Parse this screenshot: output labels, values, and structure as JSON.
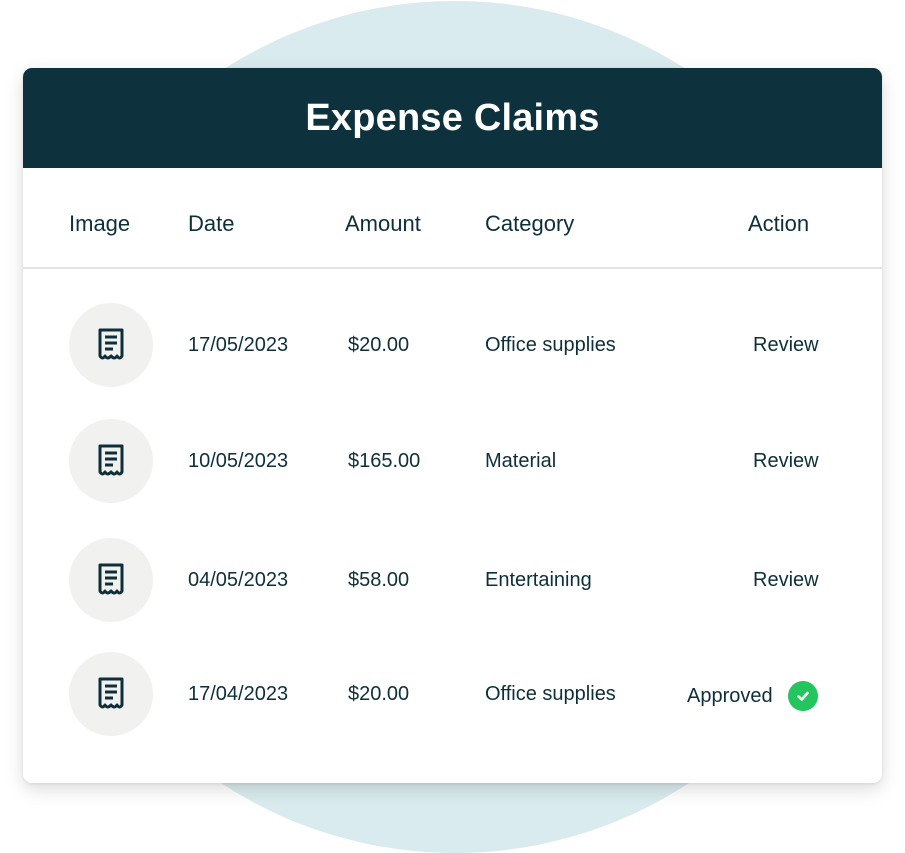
{
  "header": {
    "title": "Expense Claims"
  },
  "columns": {
    "image": "Image",
    "date": "Date",
    "amount": "Amount",
    "category": "Category",
    "action": "Action"
  },
  "rows": [
    {
      "icon": "receipt-icon",
      "date": "17/05/2023",
      "amount": "$20.00",
      "category": "Office supplies",
      "action": "Review",
      "status": "pending"
    },
    {
      "icon": "receipt-icon",
      "date": "10/05/2023",
      "amount": "$165.00",
      "category": "Material",
      "action": "Review",
      "status": "pending"
    },
    {
      "icon": "receipt-icon",
      "date": "04/05/2023",
      "amount": "$58.00",
      "category": "Entertaining",
      "action": "Review",
      "status": "pending"
    },
    {
      "icon": "receipt-icon",
      "date": "17/04/2023",
      "amount": "$20.00",
      "category": "Office supplies",
      "action": "Approved",
      "status": "approved"
    }
  ],
  "colors": {
    "header_bg": "#0d323e",
    "text": "#0e2f3a",
    "approved_badge": "#22c55e",
    "backdrop_circle": "#d9ebee",
    "thumb_bg": "#f1f1ef"
  }
}
